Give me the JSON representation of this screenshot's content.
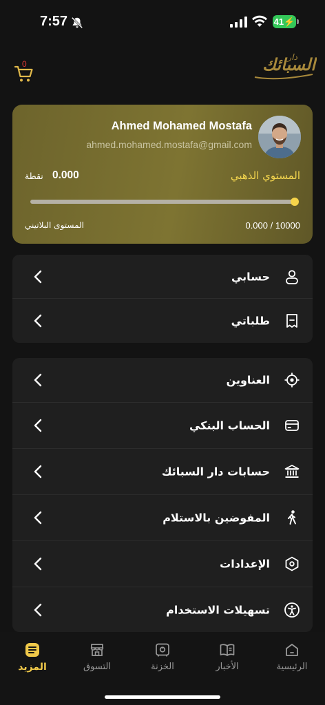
{
  "status_bar": {
    "time": "7:57",
    "battery": "41"
  },
  "header": {
    "cart_count": "0",
    "logo_text": "دار السبائك"
  },
  "profile": {
    "name": "Ahmed Mohamed Mostafa",
    "email": "ahmed.mohamed.mostafa@gmail.com",
    "level_name": "المستوي الذهبي",
    "points": "0.000",
    "points_unit": "نقطة",
    "progress_text": "0.000 / 10000",
    "progress_fraction": 0.0,
    "next_level": "المستوى البلاتيني",
    "accent_color": "#f4d64e"
  },
  "menu": {
    "group1": [
      {
        "label": "حسابي",
        "icon": "user-icon"
      },
      {
        "label": "طلباتي",
        "icon": "receipt-icon"
      }
    ],
    "group2": [
      {
        "label": "العناوين",
        "icon": "location-target-icon"
      },
      {
        "label": "الحساب البنكي",
        "icon": "card-icon"
      },
      {
        "label": "حسابات دار السبائك",
        "icon": "bank-icon"
      },
      {
        "label": "المفوضين بالاستلام",
        "icon": "walking-person-icon"
      },
      {
        "label": "الإعدادات",
        "icon": "settings-hexagon-icon"
      },
      {
        "label": "تسهيلات الاستخدام",
        "icon": "accessibility-icon"
      }
    ]
  },
  "tabs": [
    {
      "label": "الرئيسية",
      "icon": "home-icon"
    },
    {
      "label": "الأخبار",
      "icon": "book-icon"
    },
    {
      "label": "الخزنة",
      "icon": "safe-icon"
    },
    {
      "label": "التسوق",
      "icon": "store-icon"
    },
    {
      "label": "المزيد",
      "icon": "more-icon",
      "active": true
    }
  ]
}
